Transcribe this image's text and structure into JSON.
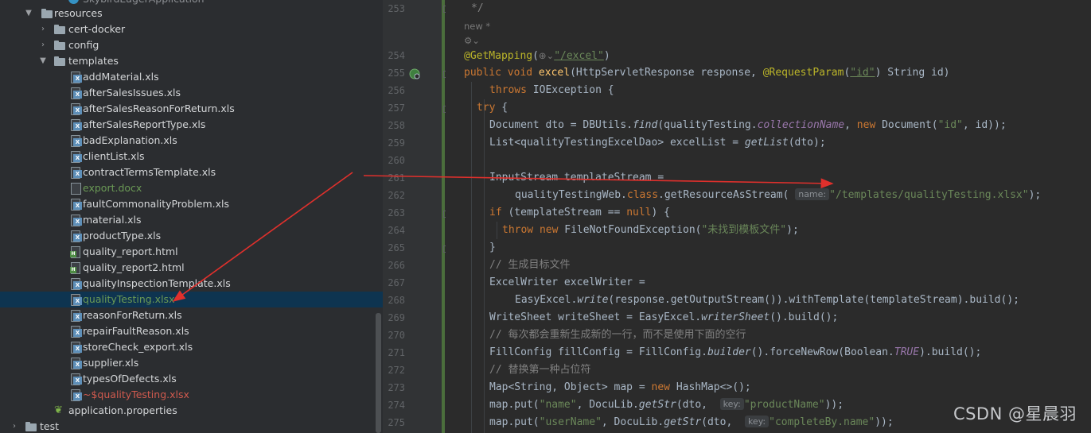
{
  "tree": {
    "items": [
      {
        "label": "SkybirdEagerApplication",
        "type": "class",
        "indent": 0
      },
      {
        "label": "resources",
        "type": "folder",
        "open": true
      },
      {
        "label": "cert-docker",
        "type": "folder",
        "open": false
      },
      {
        "label": "config",
        "type": "folder",
        "open": false
      },
      {
        "label": "templates",
        "type": "folder",
        "open": true
      },
      {
        "label": "addMaterial.xls",
        "type": "xls"
      },
      {
        "label": "afterSalesIssues.xls",
        "type": "xls"
      },
      {
        "label": "afterSalesReasonForReturn.xls",
        "type": "xls"
      },
      {
        "label": "afterSalesReportType.xls",
        "type": "xls"
      },
      {
        "label": "badExplanation.xls",
        "type": "xls"
      },
      {
        "label": "clientList.xls",
        "type": "xls"
      },
      {
        "label": "contractTermsTemplate.xls",
        "type": "xls"
      },
      {
        "label": "export.docx",
        "type": "docx"
      },
      {
        "label": "faultCommonalityProblem.xls",
        "type": "xls"
      },
      {
        "label": "material.xls",
        "type": "xls"
      },
      {
        "label": "productType.xls",
        "type": "xls"
      },
      {
        "label": "quality_report.html",
        "type": "html"
      },
      {
        "label": "quality_report2.html",
        "type": "html"
      },
      {
        "label": "qualityInspectionTemplate.xls",
        "type": "xls"
      },
      {
        "label": "qualityTesting.xlsx",
        "type": "xls",
        "selected": true
      },
      {
        "label": "reasonForReturn.xls",
        "type": "xls"
      },
      {
        "label": "repairFaultReason.xls",
        "type": "xls"
      },
      {
        "label": "storeCheck_export.xls",
        "type": "xls"
      },
      {
        "label": "supplier.xls",
        "type": "xls"
      },
      {
        "label": "typesOfDefects.xls",
        "type": "xls"
      },
      {
        "label": "~$qualityTesting.xlsx",
        "type": "xls"
      },
      {
        "label": "application.properties",
        "type": "props"
      },
      {
        "label": "test",
        "type": "folder",
        "open": false
      }
    ]
  },
  "editor": {
    "line_numbers": [
      "253",
      "254",
      "255",
      "256",
      "257",
      "258",
      "259",
      "260",
      "261",
      "262",
      "263",
      "264",
      "265",
      "266",
      "267",
      "268",
      "269",
      "270",
      "271",
      "272",
      "273",
      "274",
      "275"
    ],
    "header_comment": "*/",
    "new_badge": "new *",
    "code": {
      "l254_ann": "@GetMapping",
      "l254_path": "\"/excel\"",
      "l255_a": "public void ",
      "l255_fn": "excel",
      "l255_b": "(HttpServletResponse response, ",
      "l255_ann": "@RequestParam",
      "l255_str": "\"id\"",
      "l255_c": ") String id)",
      "l256_kw": "throws ",
      "l256_rest": "IOException {",
      "l257_kw": "try",
      "l257_rest": " {",
      "l258_a": "Document dto = DBUtils.",
      "l258_fn": "find",
      "l258_b": "(qualityTesting.",
      "l258_fld": "collectionName",
      "l258_c": ", ",
      "l258_new": "new ",
      "l258_d": "Document(",
      "l258_str": "\"id\"",
      "l258_e": ", id));",
      "l259_a": "List<qualityTestingExcelDao> excelList = ",
      "l259_fn": "getList",
      "l259_b": "(dto);",
      "l261": "InputStream templateStream =",
      "l262_a": "qualityTestingWeb.",
      "l262_kw": "class",
      "l262_b": ".getResourceAsStream( ",
      "l262_hint": "name:",
      "l262_str": "\"/templates/qualityTesting.xlsx\"",
      "l262_c": ");",
      "l263_kw": "if ",
      "l263_a": "(templateStream == ",
      "l263_null": "null",
      "l263_b": ") {",
      "l264_kw": "throw new ",
      "l264_a": "FileNotFoundException(",
      "l264_str": "\"未找到模板文件\"",
      "l264_b": ");",
      "l265": "}",
      "l266": "// 生成目标文件",
      "l267": "ExcelWriter excelWriter =",
      "l268_a": "EasyExcel.",
      "l268_fn": "write",
      "l268_b": "(response.getOutputStream()).withTemplate(templateStream).build();",
      "l269_a": "WriteSheet writeSheet = EasyExcel.",
      "l269_fn": "writerSheet",
      "l269_b": "().build();",
      "l270": "// 每次都会重新生成新的一行，而不是使用下面的空行",
      "l271_a": "FillConfig fillConfig = FillConfig.",
      "l271_fn": "builder",
      "l271_b": "().forceNewRow(Boolean.",
      "l271_fld": "TRUE",
      "l271_c": ").build();",
      "l272": "// 替换第一种占位符",
      "l273_a": "Map<String, Object> map = ",
      "l273_new": "new ",
      "l273_b": "HashMap<>();",
      "l274_a": "map.put(",
      "l274_str1": "\"name\"",
      "l274_b": ", DocuLib.",
      "l274_fn": "getStr",
      "l274_c": "(dto,  ",
      "l274_hint": "key:",
      "l274_str2": "\"productName\"",
      "l274_d": "));",
      "l275_a": "map.put(",
      "l275_str1": "\"userName\"",
      "l275_b": ", DocuLib.",
      "l275_fn": "getStr",
      "l275_c": "(dto,  ",
      "l275_hint": "key:",
      "l275_str2": "\"completeBy.name\"",
      "l275_d": "));"
    }
  },
  "watermark": "CSDN @星晨羽",
  "colors": {
    "arrow": "#e0302c",
    "selection": "#0e3450",
    "green_file": "#6a9955",
    "red_file": "#d05a4e"
  }
}
